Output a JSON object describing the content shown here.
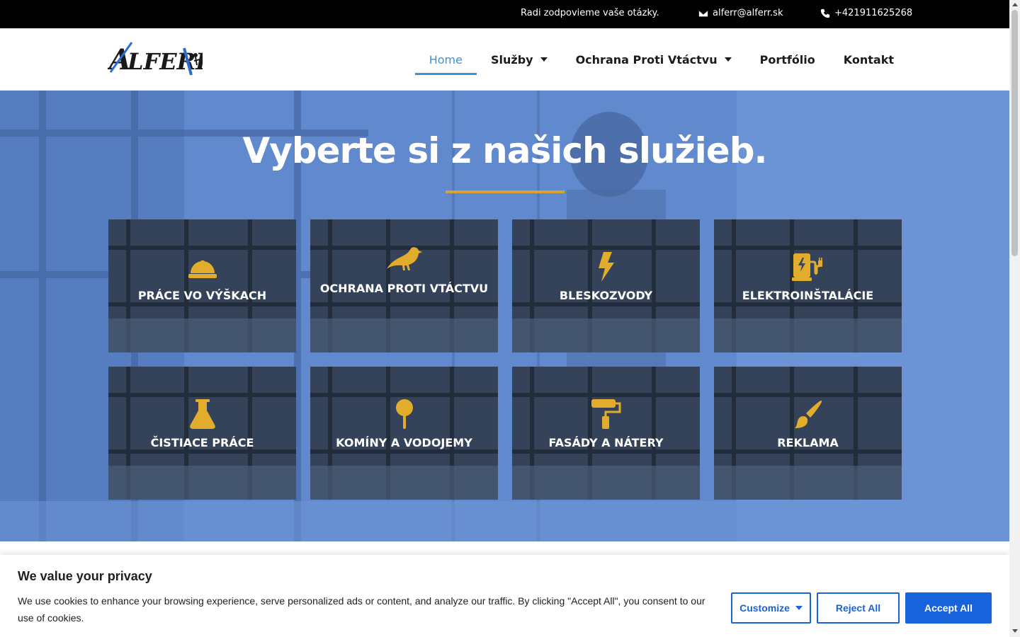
{
  "topbar": {
    "tagline": "Radi zodpovieme vaše otázky.",
    "email": "alferr@alferr.sk",
    "phone": "+421911625268",
    "email_icon": "envelope-icon",
    "phone_icon": "phone-icon"
  },
  "header": {
    "logo_text": "ALFERR",
    "nav": [
      {
        "label": "Home",
        "active": true
      },
      {
        "label": "Služby",
        "dropdown": true
      },
      {
        "label": "Ochrana Proti Vtáctvu",
        "dropdown": true
      },
      {
        "label": "Portfólio"
      },
      {
        "label": "Kontakt"
      }
    ]
  },
  "hero": {
    "title": "Vyberte si z našich služieb.",
    "accent_color": "#d9a531"
  },
  "services": [
    {
      "label": "PRÁCE VO VÝŠKACH",
      "icon": "hard-hat-icon"
    },
    {
      "label": "OCHRANA PROTI VTÁCTVU",
      "icon": "bird-icon"
    },
    {
      "label": "BLESKOZVODY",
      "icon": "lightning-icon"
    },
    {
      "label": "ELEKTROINŠTALÁCIE",
      "icon": "charging-station-icon"
    },
    {
      "label": "ČISTIACE PRÁCE",
      "icon": "flask-icon"
    },
    {
      "label": "KOMÍNY A VODOJEMY",
      "icon": "map-pin-icon"
    },
    {
      "label": "FASÁDY A NÁTERY",
      "icon": "paint-roller-icon"
    },
    {
      "label": "REKLAMA",
      "icon": "paint-brush-icon"
    }
  ],
  "cookie": {
    "title": "We value your privacy",
    "text": "We use cookies to enhance your browsing experience, serve personalized ads or content, and analyze our traffic. By clicking \"Accept All\", you consent to our use of cookies.",
    "customize": "Customize",
    "reject": "Reject All",
    "accept": "Accept All"
  },
  "colors": {
    "brand_blue": "#3b93dd",
    "icon_gold": "#e2ad2c",
    "button_blue": "#1863dc"
  }
}
